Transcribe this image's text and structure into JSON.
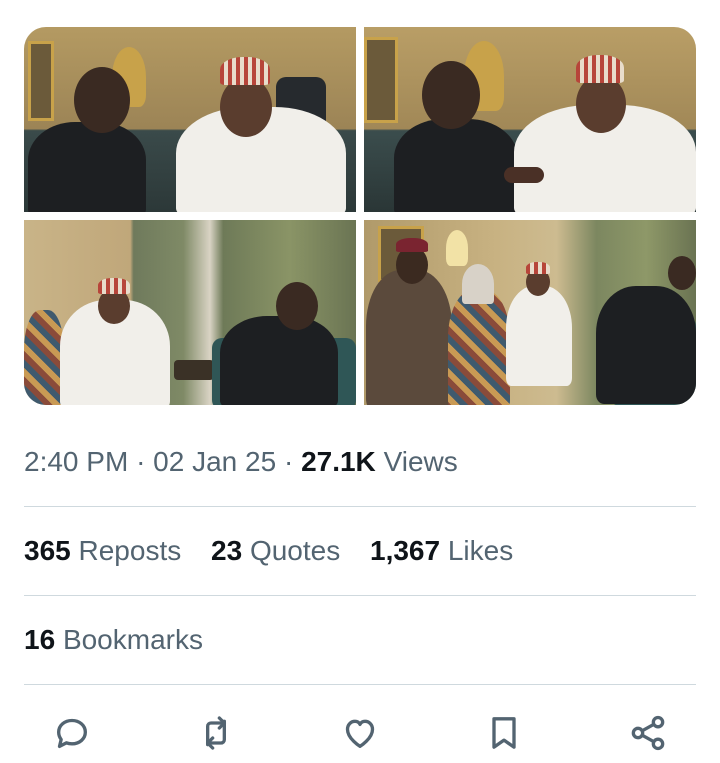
{
  "post": {
    "time": "2:40 PM",
    "date": "02 Jan 25",
    "separator": "·",
    "views_count": "27.1K",
    "views_label": "Views"
  },
  "engagement": {
    "reposts_count": "365",
    "reposts_label": "Reposts",
    "quotes_count": "23",
    "quotes_label": "Quotes",
    "likes_count": "1,367",
    "likes_label": "Likes",
    "bookmarks_count": "16",
    "bookmarks_label": "Bookmarks"
  },
  "actions": [
    {
      "icon": "reply-icon"
    },
    {
      "icon": "repost-icon"
    },
    {
      "icon": "like-icon"
    },
    {
      "icon": "bookmark-icon"
    },
    {
      "icon": "share-icon"
    }
  ],
  "colors": {
    "primary_text": "#0f1419",
    "secondary_text": "#536471",
    "divider": "#cfd9de",
    "icon": "#536471"
  }
}
